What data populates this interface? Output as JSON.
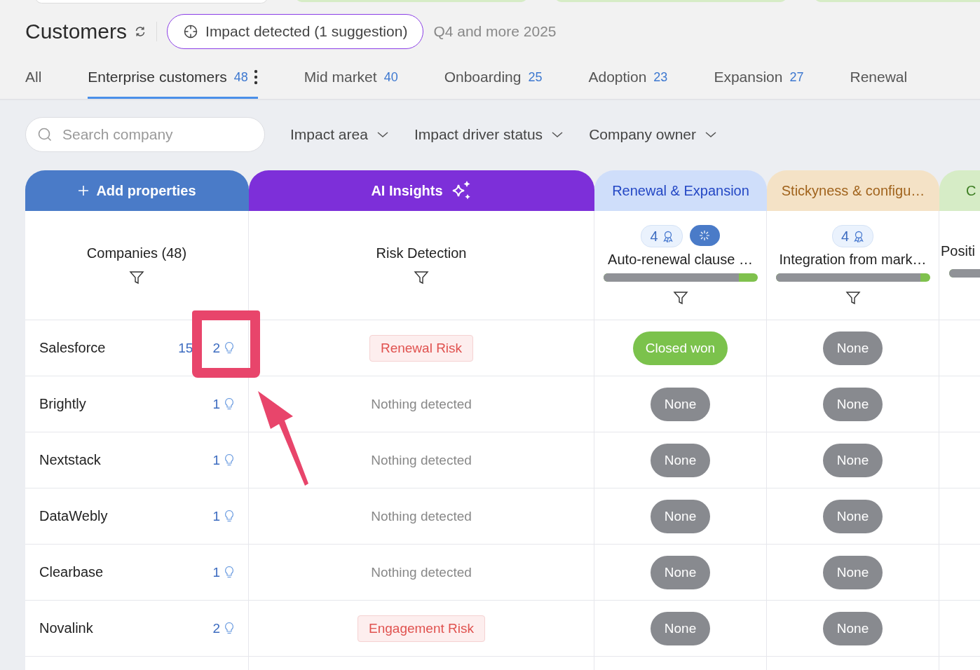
{
  "header": {
    "title": "Customers",
    "impact_button": "Impact detected (1 suggestion)",
    "period": "Q4 and more 2025"
  },
  "tabs": [
    {
      "label": "All",
      "selected": false
    },
    {
      "label": "Enterprise customers",
      "count": "48",
      "selected": true
    },
    {
      "label": "Mid market",
      "count": "40",
      "selected": false
    },
    {
      "label": "Onboarding",
      "count": "25",
      "selected": false
    },
    {
      "label": "Adoption",
      "count": "23",
      "selected": false
    },
    {
      "label": "Expansion",
      "count": "27",
      "selected": false
    },
    {
      "label": "Renewal",
      "selected": false
    }
  ],
  "search": {
    "placeholder": "Search company"
  },
  "filters": [
    "Impact area",
    "Impact driver status",
    "Company owner"
  ],
  "groups": [
    {
      "kind": "add",
      "label": "Add properties"
    },
    {
      "kind": "ai",
      "label": "AI Insights"
    },
    {
      "kind": "blue",
      "label": "Renewal & Expansion"
    },
    {
      "kind": "orange",
      "label": "Stickyness & configu…"
    },
    {
      "kind": "green",
      "label": "C"
    }
  ],
  "columns": [
    {
      "kind": "plain",
      "label": "Companies (48)"
    },
    {
      "kind": "plain",
      "label": "Risk Detection"
    },
    {
      "kind": "property",
      "label": "Auto-renewal clause …",
      "badge": "4",
      "ai_button": true,
      "level": 0.88
    },
    {
      "kind": "property",
      "label": "Integration from mark…",
      "badge": "4",
      "level": 0.94
    },
    {
      "kind": "partial",
      "label": "Positi",
      "level": 1
    }
  ],
  "rows": [
    {
      "company": "Salesforce",
      "extra": "15",
      "insights": "2",
      "risk": {
        "kind": "risk",
        "text": "Renewal Risk"
      },
      "statuses": [
        {
          "kind": "won",
          "label": "Closed won"
        },
        {
          "kind": "none",
          "label": "None"
        }
      ]
    },
    {
      "company": "Brightly",
      "insights": "1",
      "risk": {
        "kind": "none",
        "text": "Nothing detected"
      },
      "statuses": [
        {
          "kind": "none",
          "label": "None"
        },
        {
          "kind": "none",
          "label": "None"
        }
      ]
    },
    {
      "company": "Nextstack",
      "insights": "1",
      "risk": {
        "kind": "none",
        "text": "Nothing detected"
      },
      "statuses": [
        {
          "kind": "none",
          "label": "None"
        },
        {
          "kind": "none",
          "label": "None"
        }
      ]
    },
    {
      "company": "DataWebly",
      "insights": "1",
      "risk": {
        "kind": "none",
        "text": "Nothing detected"
      },
      "statuses": [
        {
          "kind": "none",
          "label": "None"
        },
        {
          "kind": "none",
          "label": "None"
        }
      ]
    },
    {
      "company": "Clearbase",
      "insights": "1",
      "risk": {
        "kind": "none",
        "text": "Nothing detected"
      },
      "statuses": [
        {
          "kind": "none",
          "label": "None"
        },
        {
          "kind": "none",
          "label": "None"
        }
      ]
    },
    {
      "company": "Novalink",
      "insights": "2",
      "risk": {
        "kind": "risk",
        "text": "Engagement Risk"
      },
      "statuses": [
        {
          "kind": "none",
          "label": "None"
        },
        {
          "kind": "none",
          "label": "None"
        }
      ]
    }
  ]
}
